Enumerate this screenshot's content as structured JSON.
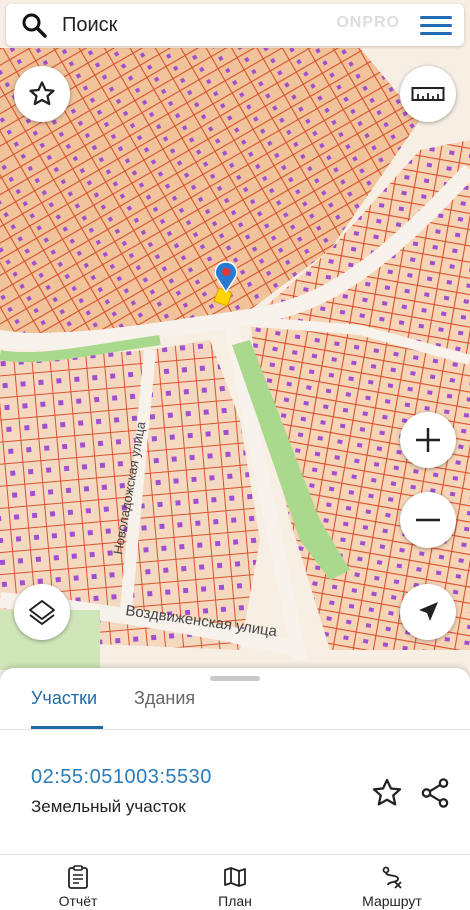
{
  "search": {
    "placeholder": "Поиск",
    "watermark": "ONPRO"
  },
  "map": {
    "street_labels": [
      "Воздвиженская улица",
      "Новоладожская улица"
    ],
    "colors": {
      "parcel_fill": "#f2c9a0",
      "parcel_border": "#d9532e",
      "building": "#a04fd1",
      "park": "#a9d98c",
      "road": "#f7f3ec"
    }
  },
  "controls": {
    "favorite_icon": "star-outline-icon",
    "ruler_icon": "ruler-icon",
    "zoom_in_icon": "plus-icon",
    "zoom_out_icon": "minus-icon",
    "layers_icon": "layers-icon",
    "locate_icon": "navigation-arrow-icon"
  },
  "panel": {
    "tabs": [
      {
        "label": "Участки",
        "active": true
      },
      {
        "label": "Здания",
        "active": false
      }
    ],
    "parcel": {
      "cadastral_number": "02:55:051003:5530",
      "type": "Земельный участок"
    }
  },
  "bottom_nav": [
    {
      "label": "Отчёт",
      "icon": "clipboard-icon"
    },
    {
      "label": "План",
      "icon": "map-icon"
    },
    {
      "label": "Маршрут",
      "icon": "route-icon"
    }
  ],
  "accent_color": "#1e6aa8"
}
